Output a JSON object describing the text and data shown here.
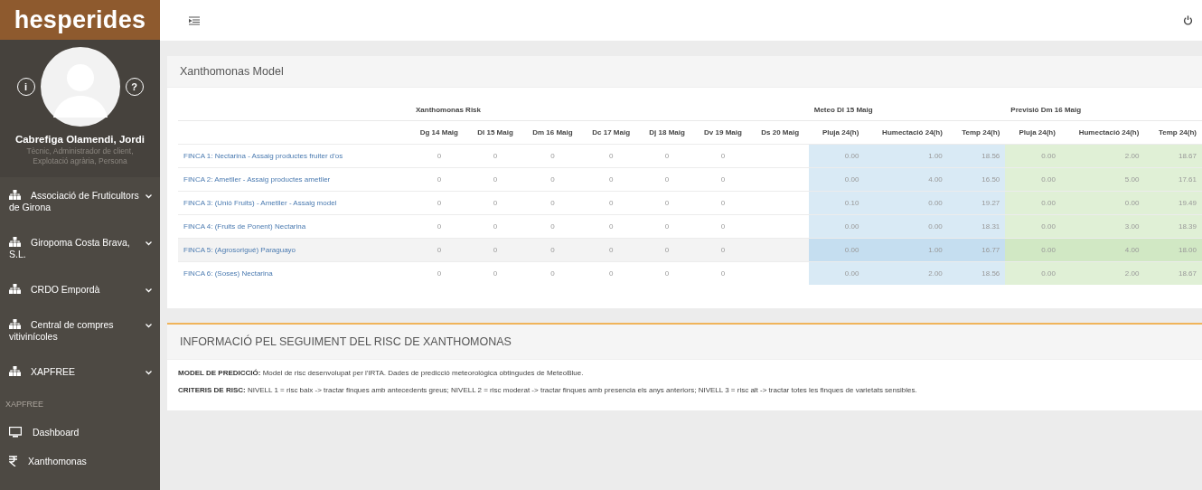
{
  "sidebar": {
    "logo": "hesperides",
    "profile": {
      "info_button": "i",
      "help_button": "?",
      "name": "Cabrefiga Olamendi, Jordi",
      "roles": "Tècnic, Administrador de client, Explotació agrària, Persona"
    },
    "organizations": [
      {
        "label": "Associació de Fruticultors de Girona"
      },
      {
        "label": "Giropoma Costa Brava, S.L."
      },
      {
        "label": "CRDO Empordà"
      },
      {
        "label": "Central de compres vitivinícoles"
      },
      {
        "label": "XAPFREE"
      }
    ],
    "section": "XAPFREE",
    "items": [
      {
        "label": "Dashboard",
        "kind": "monitor"
      },
      {
        "label": "Xanthomonas",
        "kind": "rupee"
      }
    ]
  },
  "model_card": {
    "title": "Xanthomonas Model",
    "table": {
      "groups": [
        {
          "kind": "risk",
          "title": "Xanthomonas Risk",
          "columns": [
            "Dg 14 Maig",
            "Dl 15 Maig",
            "Dm 16 Maig",
            "Dc 17 Maig",
            "Dj 18 Maig",
            "Dv 19 Maig",
            "Ds 20 Maig"
          ]
        },
        {
          "kind": "meteo",
          "title": "Meteo Dl 15 Maig",
          "columns": [
            "Pluja 24(h)",
            "Humectació 24(h)",
            "Temp 24(h)"
          ]
        },
        {
          "kind": "forecast",
          "title": "Previsió Dm 16 Maig",
          "columns": [
            "Pluja 24(h)",
            "Humectació 24(h)",
            "Temp 24(h)"
          ]
        }
      ],
      "rows": [
        {
          "name": "FINCA 1: Nectarina - Assaig productes fruiter d'os",
          "selected": false,
          "cells": [
            [
              "0",
              "0",
              "0",
              "0",
              "0",
              "0"
            ],
            [
              "0.00",
              "1.00",
              "18.56"
            ],
            [
              "0.00",
              "2.00",
              "18.67"
            ]
          ]
        },
        {
          "name": "FINCA 2: Ametller - Assaig productes ametller",
          "selected": false,
          "cells": [
            [
              "0",
              "0",
              "0",
              "0",
              "0",
              "0"
            ],
            [
              "0.00",
              "4.00",
              "16.50"
            ],
            [
              "0.00",
              "5.00",
              "17.61"
            ]
          ]
        },
        {
          "name": "FINCA 3: (Unió Fruits) - Ametller - Assaig model",
          "selected": false,
          "cells": [
            [
              "0",
              "0",
              "0",
              "0",
              "0",
              "0"
            ],
            [
              "0.10",
              "0.00",
              "19.27"
            ],
            [
              "0.00",
              "0.00",
              "19.49"
            ]
          ]
        },
        {
          "name": "FINCA 4: (Fruits de Ponent) Nectarina",
          "selected": false,
          "cells": [
            [
              "0",
              "0",
              "0",
              "0",
              "0",
              "0"
            ],
            [
              "0.00",
              "0.00",
              "18.31"
            ],
            [
              "0.00",
              "3.00",
              "18.39"
            ]
          ]
        },
        {
          "name": "FINCA 5: (Agrosorigué) Paraguayo",
          "selected": true,
          "cells": [
            [
              "0",
              "0",
              "0",
              "0",
              "0",
              "0"
            ],
            [
              "0.00",
              "1.00",
              "16.77"
            ],
            [
              "0.00",
              "4.00",
              "18.00"
            ]
          ]
        },
        {
          "name": "FINCA 6: (Soses) Nectarina",
          "selected": false,
          "cells": [
            [
              "0",
              "0",
              "0",
              "0",
              "0",
              "0"
            ],
            [
              "0.00",
              "2.00",
              "18.56"
            ],
            [
              "0.00",
              "2.00",
              "18.67"
            ]
          ]
        }
      ]
    }
  },
  "info_card": {
    "title": "INFORMACIÓ PEL SEGUIMENT DEL RISC DE XANTHOMONAS",
    "paragraphs": [
      "**MODEL DE PREDICCIÓ:** Model de risc desenvolupat per l'IRTA. Dades de predicció meteorològica obtingudes de MeteoBlue.",
      "**CRITERIS DE RISC:** NIVELL 1 = risc baix -> tractar finques amb antecedents greus; NIVELL 2 = risc moderat -> tractar finques amb presencia els anys anteriors; NIVELL 3 = risc alt -> tractar totes les finques de varietats sensibles."
    ]
  }
}
